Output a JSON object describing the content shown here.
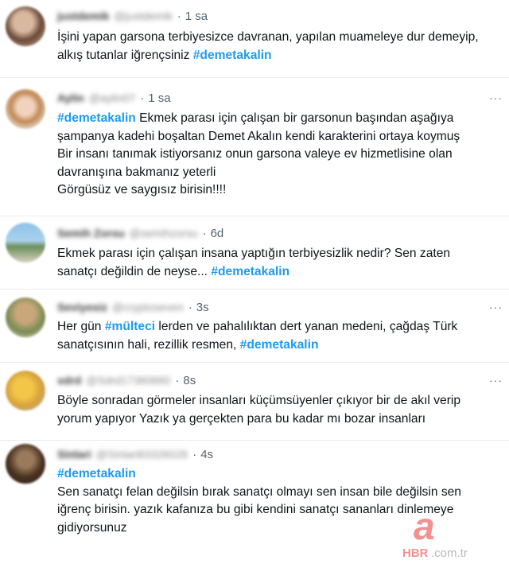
{
  "tweets": [
    {
      "name": "justdemik",
      "handle": "@justdemik",
      "time": "1 sa",
      "lines": [
        [
          {
            "t": "İşini yapan garsona terbiyesizce davranan, yapılan muameleye dur demeyip,"
          }
        ],
        [
          {
            "t": "alkış tutanlar iğrençsiniz "
          },
          {
            "t": "#demetakalin",
            "tag": true
          }
        ]
      ]
    },
    {
      "name": "Aylin",
      "handle": "@aylin07",
      "time": "1 sa",
      "lines": [
        [
          {
            "t": "#demetakalin",
            "tag": true
          },
          {
            "t": " Ekmek parası için çalışan bir garsonun başından  aşağıya"
          }
        ],
        [
          {
            "t": "şampanya kadehi boşaltan Demet Akalın kendi karakterini ortaya koymuş"
          }
        ],
        [
          {
            "t": "Bir insanı tanımak istiyorsanız onun garsona valeye ev hizmetlisine olan"
          }
        ],
        [
          {
            "t": "davranışına bakmanız yeterli"
          }
        ],
        [
          {
            "t": "Görgüsüz ve saygısız birisin!!!!"
          }
        ]
      ]
    },
    {
      "name": "Semih Zorsu",
      "handle": "@semihzorsu",
      "time": "6d",
      "lines": [
        [
          {
            "t": "Ekmek parası için çalışan insana yaptığın terbiyesizlik nedir? Sen zaten"
          }
        ],
        [
          {
            "t": "sanatçı değildin de neyse... "
          },
          {
            "t": "#demetakalin",
            "tag": true
          }
        ]
      ]
    },
    {
      "name": "Seviyesiz",
      "handle": "@cryptoseven",
      "time": "3s",
      "lines": [
        [
          {
            "t": "Her gün "
          },
          {
            "t": "#mülteci",
            "tag": true
          },
          {
            "t": " lerden ve pahalılıktan dert yanan medeni, çağdaş Türk"
          }
        ],
        [
          {
            "t": "sanatçısının hali, rezillik resmen, "
          },
          {
            "t": "#demetakalin",
            "tag": true
          }
        ]
      ]
    },
    {
      "name": "sdrd",
      "handle": "@Sdrd17360660",
      "time": "8s",
      "lines": [
        [
          {
            "t": "Böyle sonradan görmeler insanları küçümsüyenler çıkıyor  bir de akıl verip"
          }
        ],
        [
          {
            "t": "yorum yapıyor Yazık ya gerçekten para bu kadar mı bozar insanları"
          }
        ]
      ]
    },
    {
      "name": "Sinlari",
      "handle": "@Sinlari83326026",
      "time": "4s",
      "lines": [
        [
          {
            "t": "#demetakalin",
            "tag": true
          }
        ],
        [
          {
            "t": "Sen sanatçı felan değilsin bırak sanatçı olmayı sen insan bile değilsin sen"
          }
        ],
        [
          {
            "t": "iğrenç birisin. yazık kafanıza bu gibi kendini sanatçı sananları dinlemeye"
          }
        ],
        [
          {
            "t": "gidiyorsunuz"
          }
        ]
      ]
    }
  ],
  "more_label": "···",
  "watermark": {
    "letter": "a",
    "brand": "HBR",
    "suffix": ".com.tr"
  }
}
